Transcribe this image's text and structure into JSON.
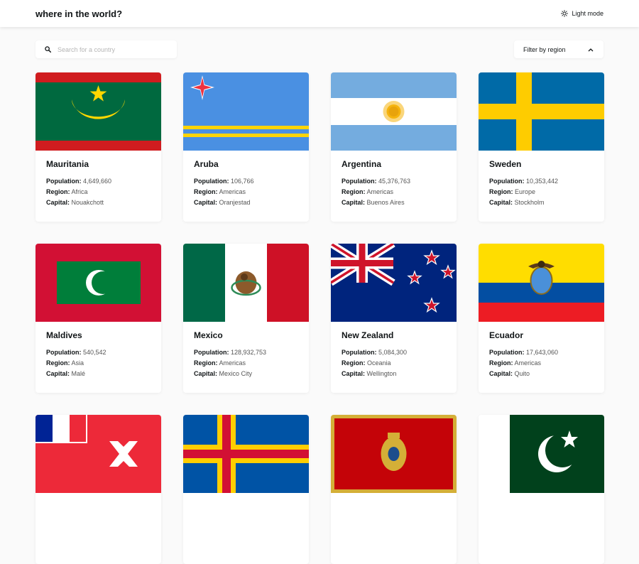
{
  "header": {
    "title": "where in the world?",
    "mode_label": "Light mode",
    "mode_icon": "sun-icon"
  },
  "search": {
    "placeholder": "Search for a country",
    "value": "",
    "icon": "search-icon"
  },
  "filter": {
    "label": "Filter by region",
    "icon": "chevron-up-icon"
  },
  "labels": {
    "population": "Population:",
    "region": "Region:",
    "capital": "Capital:"
  },
  "countries": [
    {
      "name": "Mauritania",
      "population": "4,649,660",
      "region": "Africa",
      "capital": "Nouakchott"
    },
    {
      "name": "Aruba",
      "population": "106,766",
      "region": "Americas",
      "capital": "Oranjestad"
    },
    {
      "name": "Argentina",
      "population": "45,376,763",
      "region": "Americas",
      "capital": "Buenos Aires"
    },
    {
      "name": "Sweden",
      "population": "10,353,442",
      "region": "Europe",
      "capital": "Stockholm"
    },
    {
      "name": "Maldives",
      "population": "540,542",
      "region": "Asia",
      "capital": "Malé"
    },
    {
      "name": "Mexico",
      "population": "128,932,753",
      "region": "Americas",
      "capital": "Mexico City"
    },
    {
      "name": "New Zealand",
      "population": "5,084,300",
      "region": "Oceania",
      "capital": "Wellington"
    },
    {
      "name": "Ecuador",
      "population": "17,643,060",
      "region": "Americas",
      "capital": "Quito"
    },
    {
      "name": "",
      "population": "",
      "region": "",
      "capital": ""
    },
    {
      "name": "",
      "population": "",
      "region": "",
      "capital": ""
    },
    {
      "name": "",
      "population": "",
      "region": "",
      "capital": ""
    },
    {
      "name": "",
      "population": "",
      "region": "",
      "capital": ""
    }
  ]
}
